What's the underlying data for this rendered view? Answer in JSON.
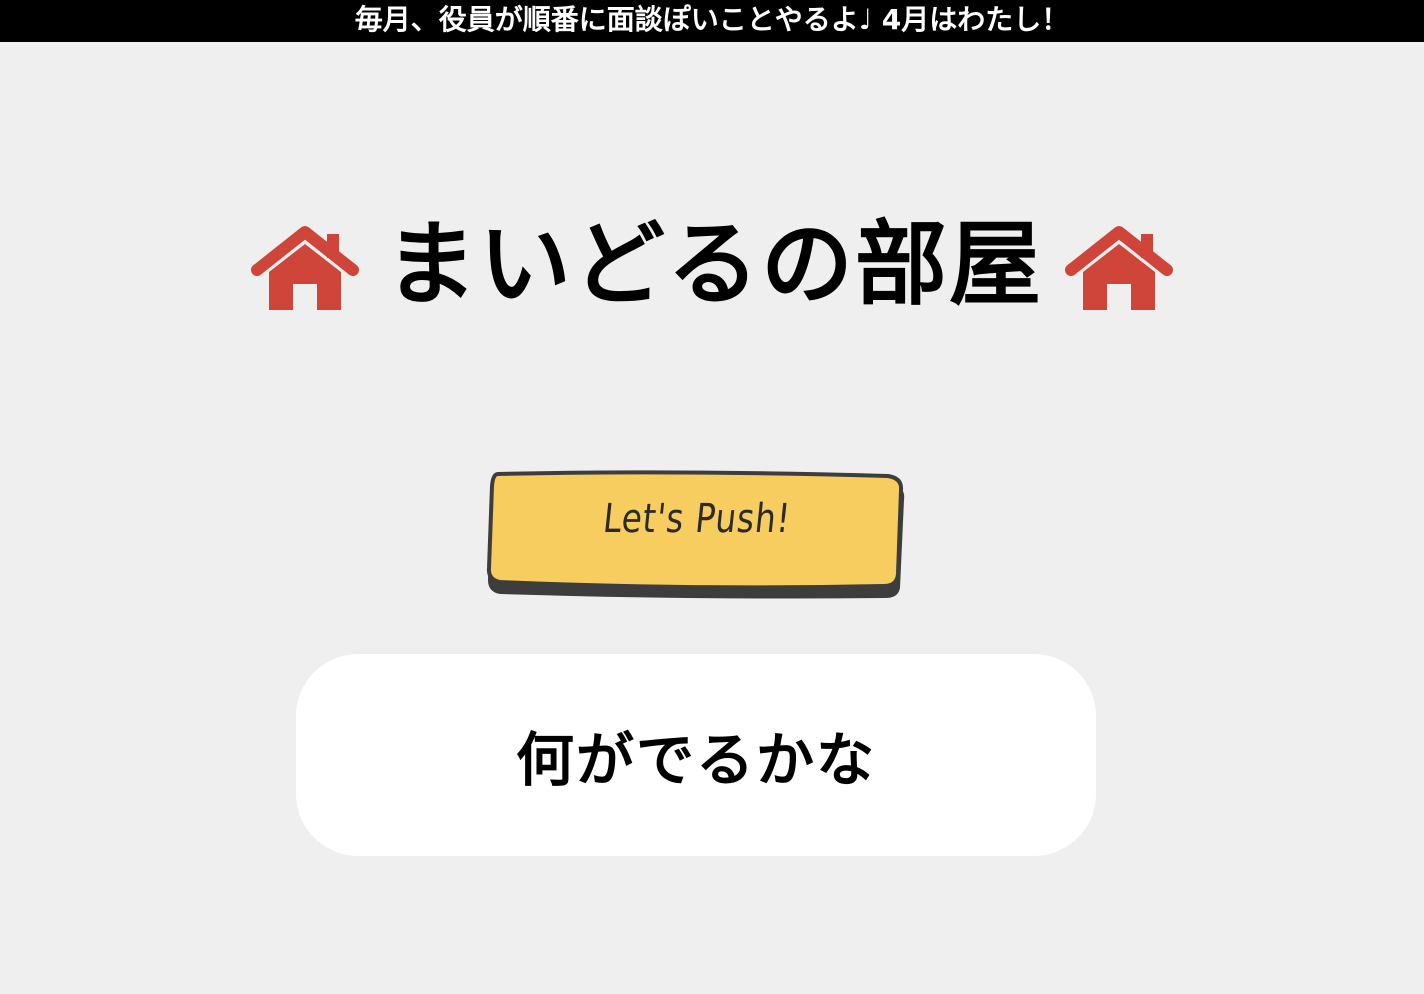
{
  "banner": {
    "text": "毎月、役員が順番に面談ぽいことやるよ♩ 4月はわたし！"
  },
  "header": {
    "title": "まいどるの部屋",
    "icon_left": "house-icon",
    "icon_right": "house-icon"
  },
  "push_button": {
    "label": "Let's Push!"
  },
  "result": {
    "text": "何がでるかな"
  },
  "colors": {
    "background": "#efefef",
    "banner_bg": "#000000",
    "banner_text": "#ffffff",
    "house_icon": "#d0453a",
    "button_fill": "#f8cd5f",
    "button_border": "#3d3d3d",
    "result_bg": "#ffffff"
  }
}
